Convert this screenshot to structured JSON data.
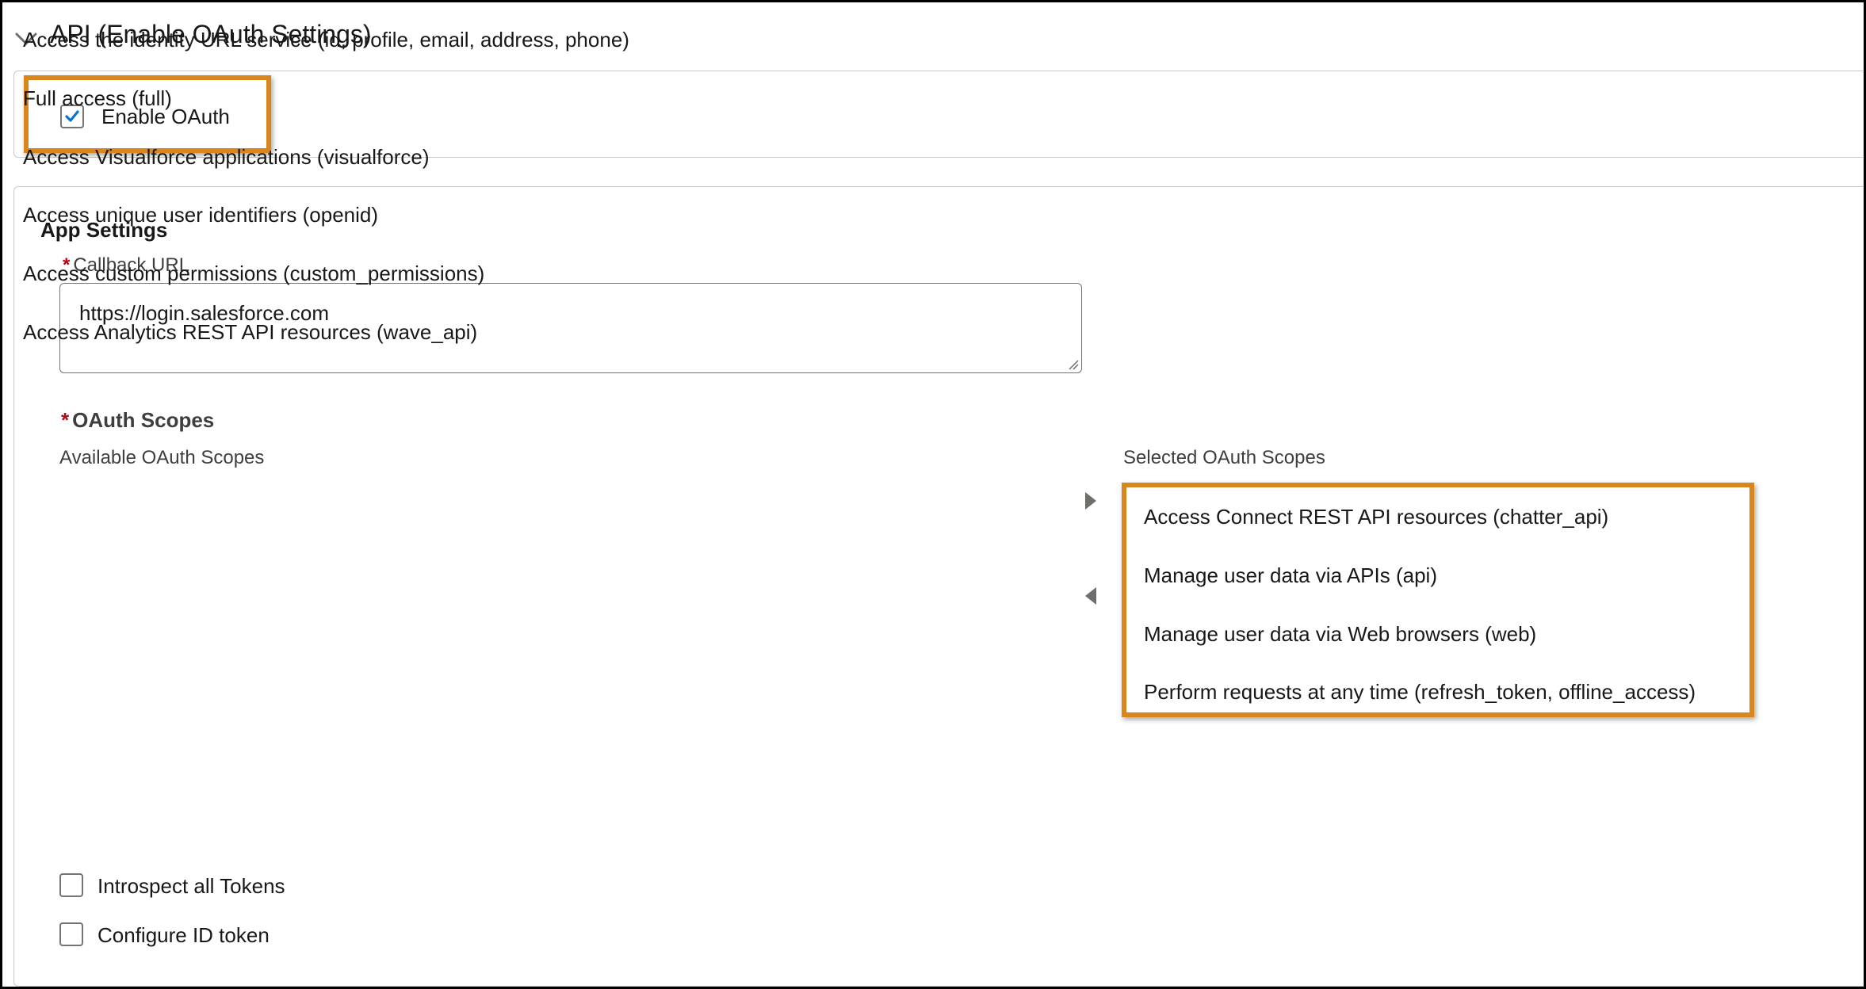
{
  "section": {
    "title": "API (Enable OAuth Settings)",
    "icon": "chevron-down-icon"
  },
  "enable_oauth": {
    "label": "Enable OAuth",
    "checked": true
  },
  "app_settings": {
    "title": "App Settings",
    "callback_url": {
      "required_marker": "*",
      "label": "Callback URL",
      "value": "https://login.salesforce.com"
    },
    "oauth_scopes": {
      "required_marker": "*",
      "label": "OAuth Scopes",
      "available_label": "Available OAuth Scopes",
      "selected_label": "Selected OAuth Scopes",
      "available": [
        "Access the identity URL service (id, profile, email, address, phone)",
        "Full access (full)",
        "Access Visualforce applications (visualforce)",
        "Access unique user identifiers (openid)",
        "Access custom permissions (custom_permissions)",
        "Access Analytics REST API resources (wave_api)"
      ],
      "selected": [
        "Access Connect REST API resources (chatter_api)",
        "Manage user data via APIs (api)",
        "Manage user data via Web browsers (web)",
        "Perform requests at any time (refresh_token, offline_access)"
      ],
      "move_right_icon": "triangle-right-icon",
      "move_left_icon": "triangle-left-icon"
    },
    "introspect_tokens": {
      "label": "Introspect all Tokens",
      "checked": false
    },
    "configure_id_token": {
      "label": "Configure ID token",
      "checked": false
    }
  },
  "colors": {
    "highlight": "#d9861c",
    "checkmark": "#0176d3",
    "required": "#ba0517",
    "border": "#c9c9c9"
  }
}
